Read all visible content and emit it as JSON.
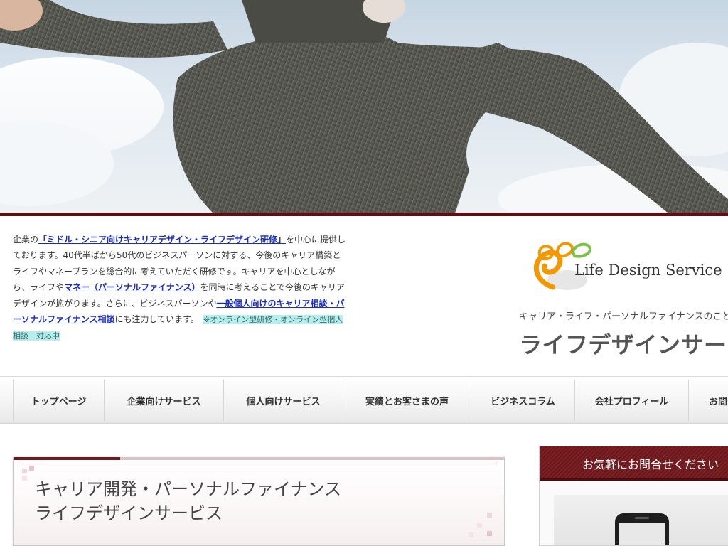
{
  "intro": {
    "text_1": "企業の",
    "link_1": "「ミドル・シニア向けキャリアデザイン・ライフデザイン研修」",
    "text_2": "を中心に提供しております。40代半ばから50代のビジネスパーソンに対する、今後のキャリア構築とライフやマネープランを総合的に考えていただく研修です。キャリアを中心としながら、ライフや",
    "link_2": "マネー（パーソナルファイナンス）",
    "text_3": "を同時に考えることで今後のキャリアデザインが拡がります。さらに、ビジネスパーソンや",
    "link_3": "一般個人向けのキャリア相談・パーソナルファイナンス相談",
    "text_4": "にも注力しています。",
    "highlight": "※オンライン型研修・オンライン型個人相談　対応中"
  },
  "logo": {
    "text": "Life Design Service",
    "colors": {
      "orange": "#f39800",
      "green": "#7cc04a",
      "gray": "#9a9a9a"
    }
  },
  "header": {
    "tagline": "キャリア・ライフ・パーソナルファイナンスのことなら",
    "brand": "ライフデザインサービス"
  },
  "nav": {
    "items": [
      {
        "label": "トップページ"
      },
      {
        "label": "企業向けサービス"
      },
      {
        "label": "個人向けサービス"
      },
      {
        "label": "実績とお客さまの声"
      },
      {
        "label": "ビジネスコラム"
      },
      {
        "label": "会社プロフィール"
      },
      {
        "label": "お問合せ"
      }
    ]
  },
  "main": {
    "title_line1": "キャリア開発・パーソナルファイナンス",
    "title_line2": "ライフデザインサービス"
  },
  "sidebar": {
    "contact_title": "お気軽にお問合せください"
  },
  "colors": {
    "accent": "#5e0f12",
    "link": "#1a2bbf",
    "highlight_bg": "#b9ecec"
  }
}
